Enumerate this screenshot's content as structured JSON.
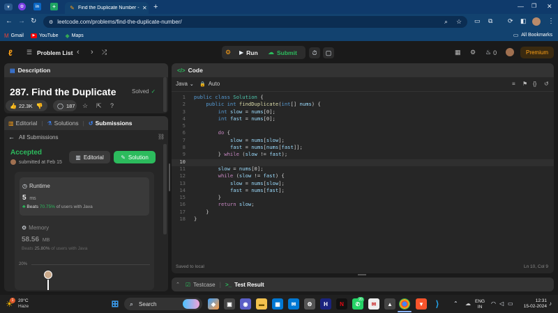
{
  "browser": {
    "tab_title": "Find the Duplicate Number - Le",
    "url": "leetcode.com/problems/find-the-duplicate-number/",
    "bookmarks": [
      {
        "label": "Gmail",
        "icon": "gmail-icon"
      },
      {
        "label": "YouTube",
        "icon": "youtube-icon"
      },
      {
        "label": "Maps",
        "icon": "maps-icon"
      }
    ],
    "all_bookmarks": "All Bookmarks"
  },
  "nav": {
    "problem_list": "Problem List",
    "run": "Run",
    "submit": "Submit",
    "fire_count": "0",
    "premium": "Premium"
  },
  "description": {
    "header": "Description",
    "title": "287. Find the Duplicate",
    "status": "Solved",
    "likes": "22.3K",
    "comments": "187"
  },
  "submissions": {
    "tabs": [
      "Editorial",
      "Solutions",
      "Submissions"
    ],
    "back_label": "All Submissions",
    "result": "Accepted",
    "submitted": "submitted at Feb 15",
    "editorial_btn": "Editorial",
    "solution_btn": "Solution",
    "runtime": {
      "label": "Runtime",
      "value": "5",
      "unit": "ms",
      "beats_word": "Beats",
      "beats": "70.75%",
      "beats_suffix": "of users with Java"
    },
    "memory": {
      "label": "Memory",
      "value": "58.56",
      "unit": "MB",
      "beats_word": "Beats",
      "beats": "25.80%",
      "beats_suffix": "of users with Java"
    },
    "chart_tick": "20%"
  },
  "code": {
    "header": "Code",
    "language": "Java",
    "mode": "Auto",
    "lines": [
      "public class Solution {",
      "    public int findDuplicate(int[] nums) {",
      "        int slow = nums[0];",
      "        int fast = nums[0];",
      "",
      "        do {",
      "            slow = nums[slow];",
      "            fast = nums[nums[fast]];",
      "        } while (slow != fast);",
      "",
      "        slow = nums[0];",
      "        while (slow != fast) {",
      "            slow = nums[slow];",
      "            fast = nums[fast];",
      "        }",
      "        return slow;",
      "    }",
      "}"
    ],
    "line_numbers": [
      "1",
      "2",
      "3",
      "4",
      "5",
      "6",
      "7",
      "8",
      "9",
      "10",
      "11",
      "12",
      "13",
      "14",
      "15",
      "16",
      "17",
      "18"
    ],
    "saved": "Saved to local",
    "position": "Ln 10, Col 9",
    "testcase": "Testcase",
    "test_result": "Test Result"
  },
  "taskbar": {
    "temp": "20°C",
    "weather": "Haze",
    "search": "Search",
    "lang1": "ENG",
    "lang2": "IN",
    "time": "12:31",
    "date": "15-02-2024",
    "whatsapp_badge": "20",
    "weather_badge": "1"
  },
  "colors": {
    "accent_green": "#2cbb5d",
    "accent_orange": "#ffa116",
    "tab_blue": "#0f3a6b",
    "panel": "#262626"
  }
}
